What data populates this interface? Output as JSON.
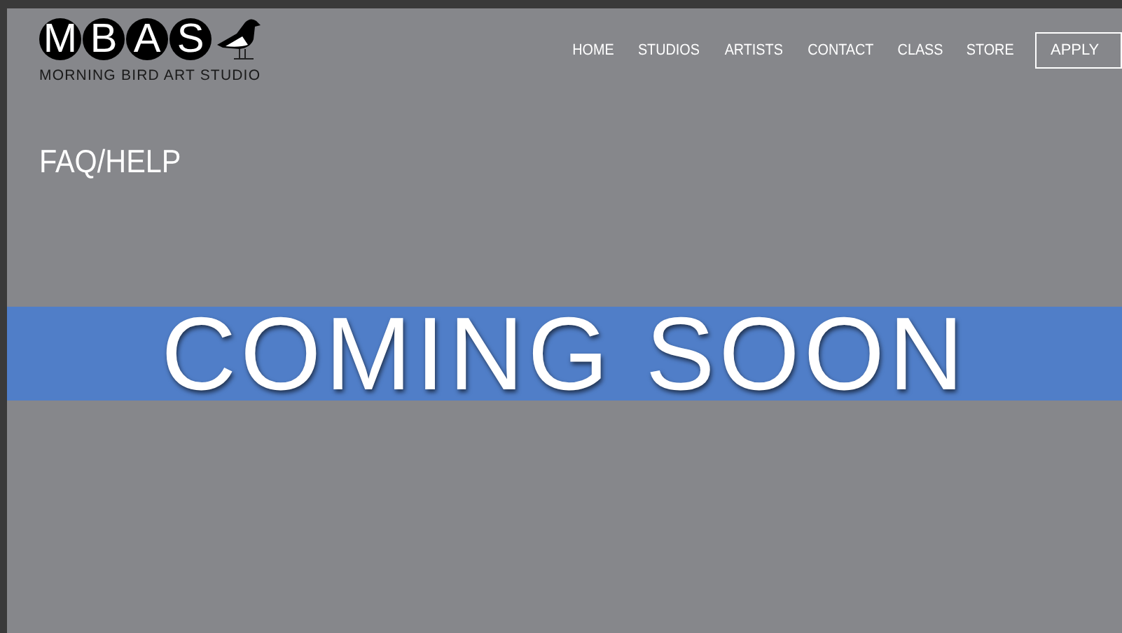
{
  "logo": {
    "letters": [
      "M",
      "B",
      "A",
      "S"
    ],
    "tagline": "MORNING BIRD ART STUDIO"
  },
  "nav": {
    "items": [
      "HOME",
      "STUDIOS",
      "ARTISTS",
      "CONTACT",
      "CLASS",
      "STORE"
    ],
    "apply": "APPLY"
  },
  "page_title": "FAQ/HELP",
  "banner": "COMING SOON"
}
